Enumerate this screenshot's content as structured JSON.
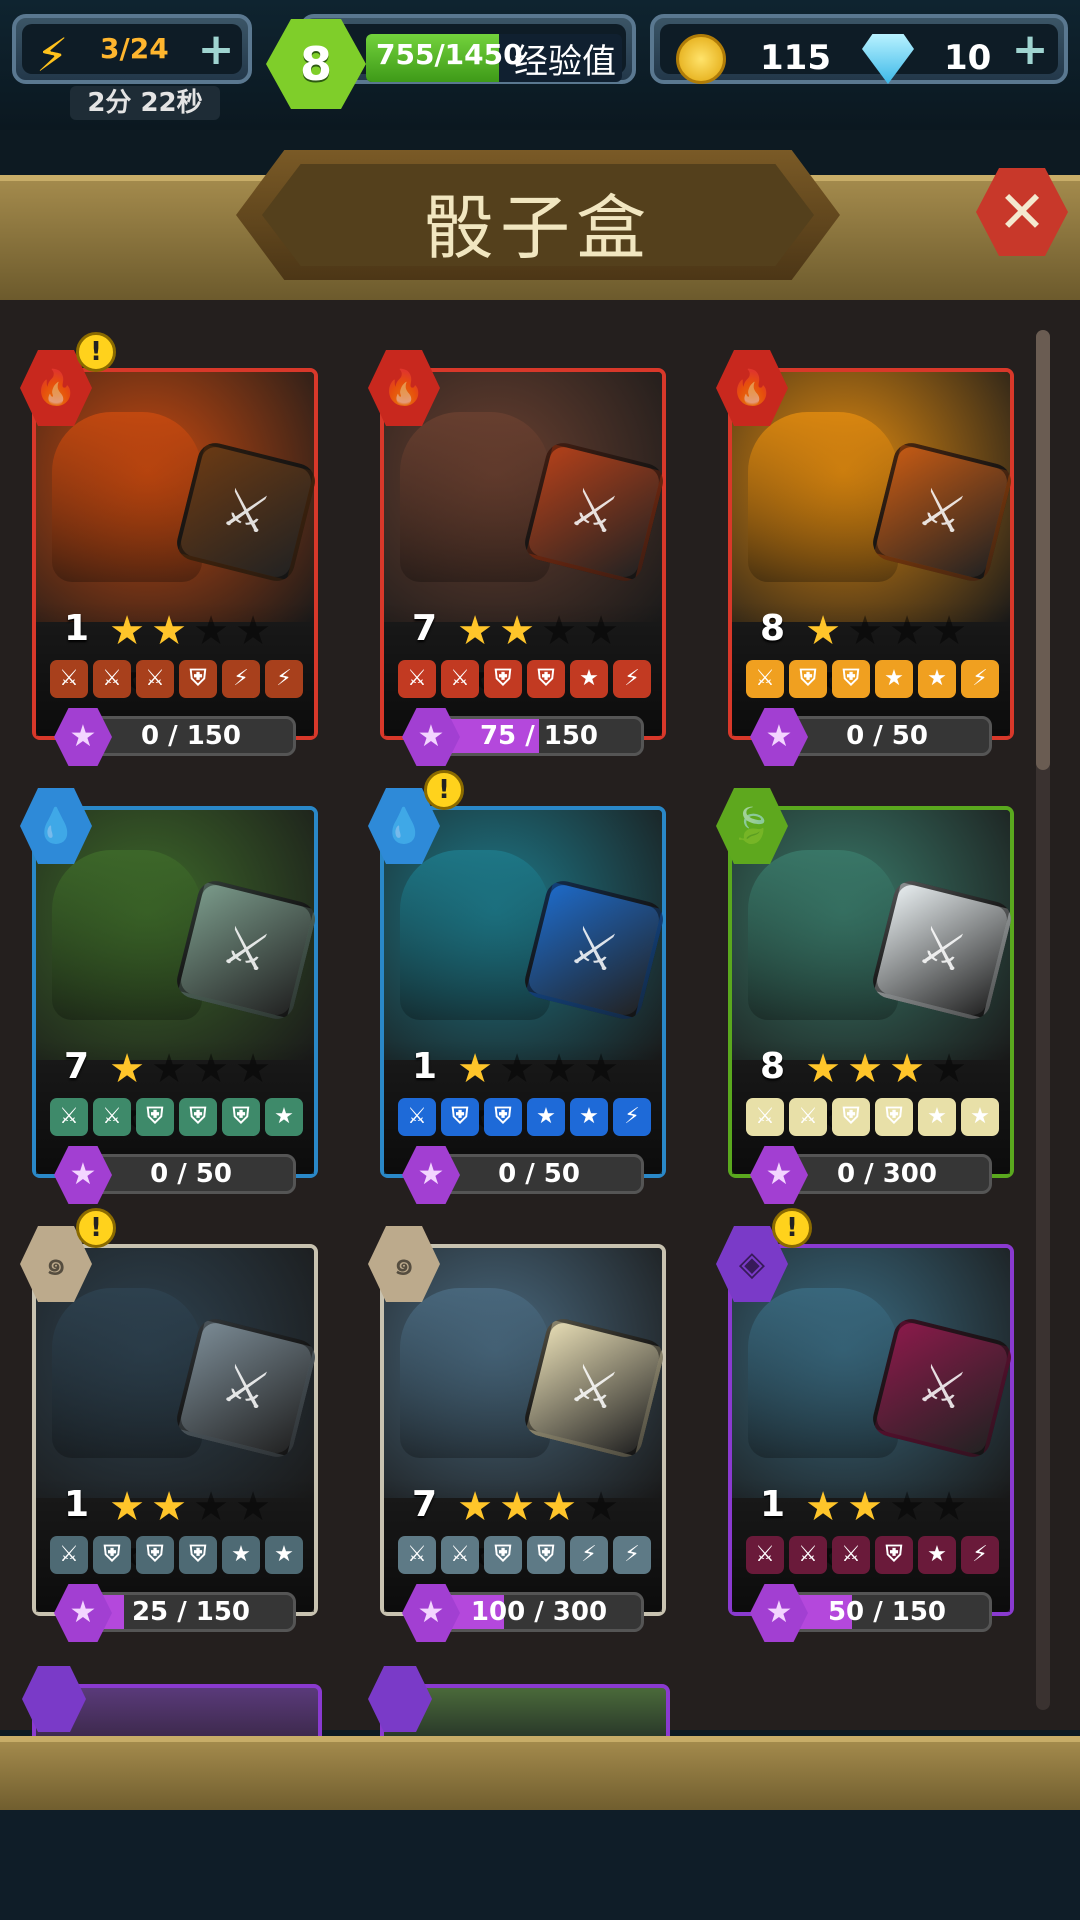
{
  "topbar": {
    "energy": "3/24",
    "energy_timer": "2分 22秒",
    "level": "8",
    "xp": "755/1450",
    "xp_fraction": 0.52,
    "xp_label": "经验值",
    "coins": "115",
    "gems": "10",
    "plus": "+"
  },
  "header": {
    "title": "骰子盒",
    "close": "✕"
  },
  "cards": [
    {
      "level": "1",
      "stars": 2,
      "element": "fire",
      "warning": true,
      "progress": "0 / 150",
      "fill": 0.0,
      "border": "#d8382a",
      "art": "#c84a10",
      "die": "#6a3a14",
      "faces": [
        "⚔",
        "⚔",
        "⚔",
        "⛨",
        "⚡",
        "⚡"
      ],
      "face_color": "#a8401c"
    },
    {
      "level": "7",
      "stars": 2,
      "element": "fire",
      "warning": false,
      "progress": "75 / 150",
      "fill": 0.5,
      "border": "#d8382a",
      "art": "#6a4030",
      "die": "#b2401a",
      "faces": [
        "⚔",
        "⚔",
        "⛨",
        "⛨",
        "★",
        "⚡"
      ],
      "face_color": "#c23a22"
    },
    {
      "level": "8",
      "stars": 1,
      "element": "fire",
      "warning": false,
      "progress": "0 / 50",
      "fill": 0.0,
      "border": "#d8382a",
      "art": "#e08a10",
      "die": "#c45a14",
      "faces": [
        "⚔",
        "⛨",
        "⛨",
        "★",
        "★",
        "⚡"
      ],
      "face_color": "#f0a020"
    },
    {
      "level": "7",
      "stars": 1,
      "element": "water",
      "warning": false,
      "progress": "0 / 50",
      "fill": 0.0,
      "border": "#2a88c8",
      "art": "#3e6a2a",
      "die": "#7a9a8a",
      "faces": [
        "⚔",
        "⚔",
        "⛨",
        "⛨",
        "⛨",
        "★"
      ],
      "face_color": "#3e8a6a"
    },
    {
      "level": "1",
      "stars": 1,
      "element": "water",
      "warning": true,
      "progress": "0 / 50",
      "fill": 0.0,
      "border": "#2a88c8",
      "art": "#1e7a8a",
      "die": "#1e6ac8",
      "faces": [
        "⚔",
        "⛨",
        "⛨",
        "★",
        "★",
        "⚡"
      ],
      "face_color": "#1e6ad8"
    },
    {
      "level": "8",
      "stars": 3,
      "element": "nature",
      "warning": false,
      "progress": "0 / 300",
      "fill": 0.0,
      "border": "#5aa81e",
      "art": "#3a7a6a",
      "die": "#e8eef0",
      "faces": [
        "⚔",
        "⚔",
        "⛨",
        "⛨",
        "★",
        "★"
      ],
      "face_color": "#e8e0a8"
    },
    {
      "level": "1",
      "stars": 2,
      "element": "neutral",
      "warning": true,
      "progress": "25 / 150",
      "fill": 0.17,
      "border": "#c8c2b0",
      "art": "#2e4250",
      "die": "#7a8a94",
      "faces": [
        "⚔",
        "⛨",
        "⛨",
        "⛨",
        "★",
        "★"
      ],
      "face_color": "#4e6a74"
    },
    {
      "level": "7",
      "stars": 3,
      "element": "neutral",
      "warning": false,
      "progress": "100 / 300",
      "fill": 0.33,
      "border": "#c8c2b0",
      "art": "#4a6a80",
      "die": "#e6dcb4",
      "faces": [
        "⚔",
        "⚔",
        "⛨",
        "⛨",
        "⚡",
        "⚡"
      ],
      "face_color": "#5e7a86"
    },
    {
      "level": "1",
      "stars": 2,
      "element": "dark",
      "warning": true,
      "progress": "50 / 150",
      "fill": 0.33,
      "border": "#8a3ad0",
      "art": "#3a6a80",
      "die": "#8a1a4a",
      "faces": [
        "⚔",
        "⚔",
        "⚔",
        "⛨",
        "★",
        "⚡"
      ],
      "face_color": "#6a1a3a"
    }
  ]
}
